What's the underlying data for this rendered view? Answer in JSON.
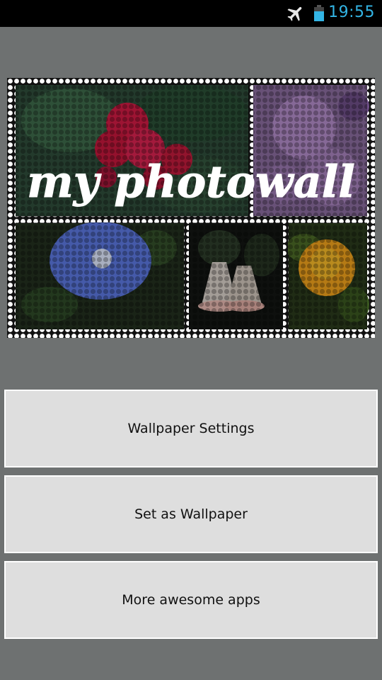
{
  "status_bar": {
    "time": "19:55",
    "icons": [
      "airplane-mode-icon",
      "battery-icon"
    ],
    "accent_color": "#33b5e5"
  },
  "banner": {
    "title": "my photowall",
    "photos": [
      "red-flower-photo",
      "purple-flower-photo",
      "blue-morning-glory-photo",
      "white-bell-flower-photo",
      "orange-marigold-photo"
    ]
  },
  "buttons": {
    "wallpaper_settings": "Wallpaper Settings",
    "set_as_wallpaper": "Set as Wallpaper",
    "more_apps": "More awesome apps"
  },
  "colors": {
    "background": "#6e7171",
    "button_bg": "#dedede",
    "button_border": "#ffffff"
  }
}
